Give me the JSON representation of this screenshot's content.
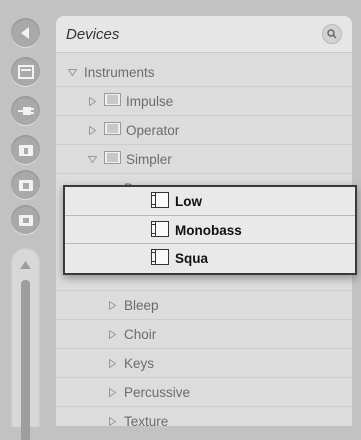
{
  "panel": {
    "title": "Devices"
  },
  "rail": {
    "icons": [
      "back-arrow-icon",
      "browser-icon",
      "plug-icon",
      "folder-1-icon",
      "folder-2-icon",
      "folder-3-icon"
    ]
  },
  "tree": {
    "instruments": "Instruments",
    "impulse": "Impulse",
    "operator": "Operator",
    "simpler": "Simpler",
    "bass": "Bass",
    "bleep": "Bleep",
    "choir": "Choir",
    "keys": "Keys",
    "percussive": "Percussive",
    "texture": "Texture"
  },
  "popup": {
    "items": [
      "Low",
      "Monobass",
      "Squa"
    ]
  },
  "colors": {
    "accent_border": "#3a3a3a",
    "panel_bg": "#dcdcdc",
    "rail_bg": "#c2c2c2"
  }
}
